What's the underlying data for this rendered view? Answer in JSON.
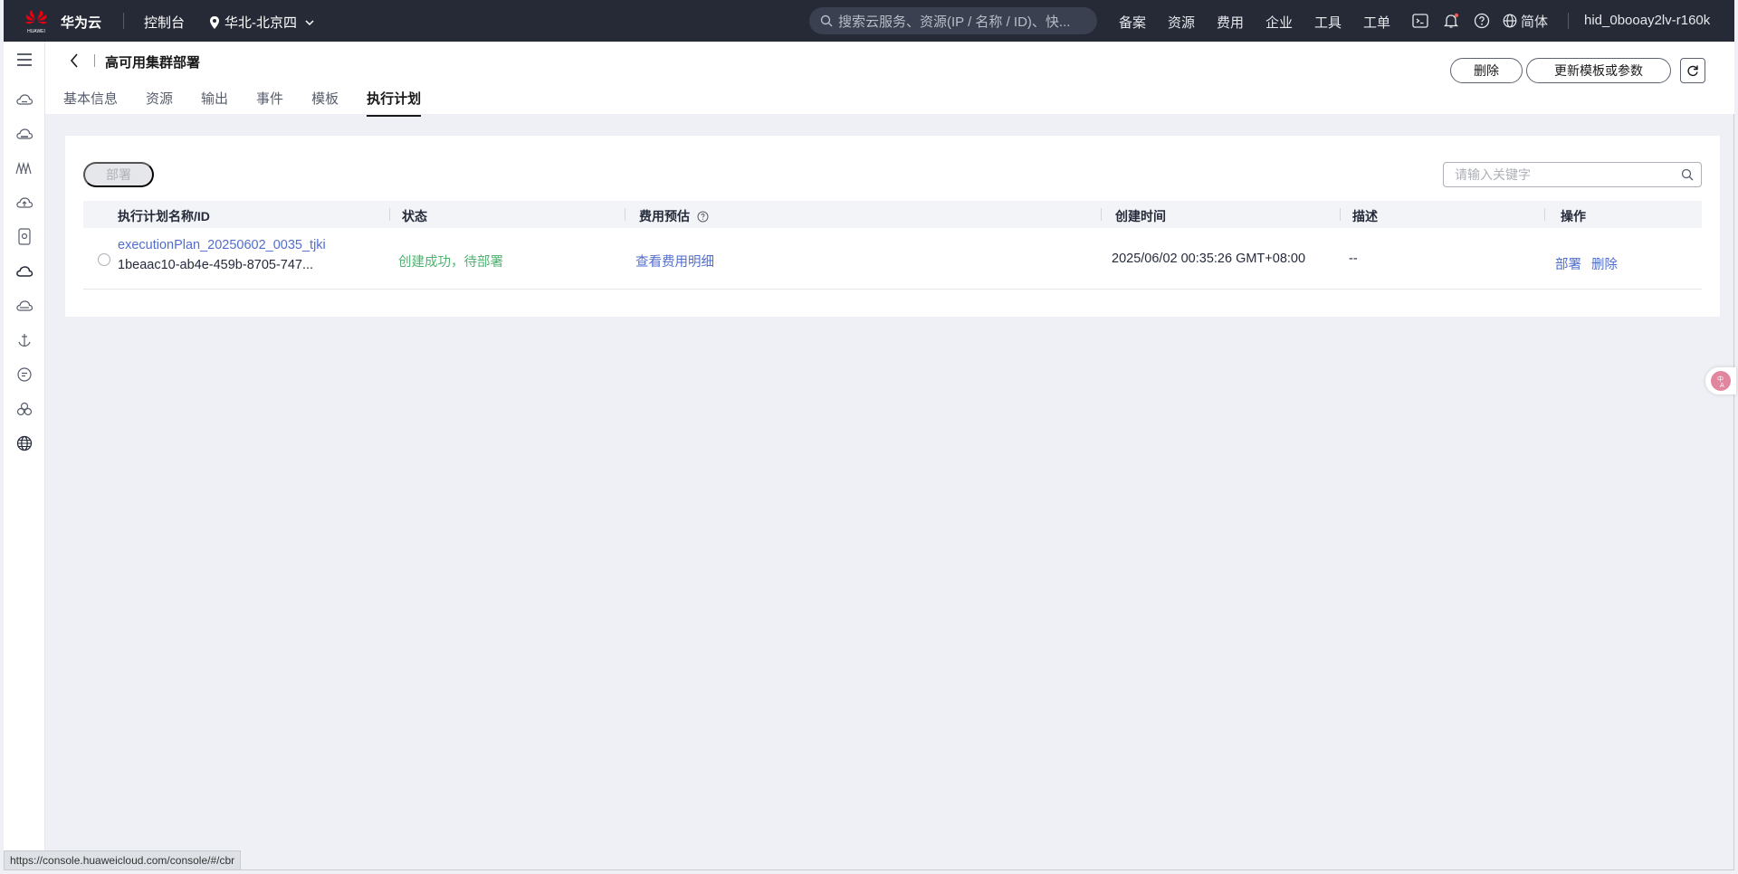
{
  "topbar": {
    "brand_text": "华为云",
    "console_label": "控制台",
    "region_label": "华北-北京四",
    "search_placeholder": "搜索云服务、资源(IP / 名称 / ID)、快...",
    "nav": [
      "备案",
      "资源",
      "费用",
      "企业",
      "工具",
      "工单"
    ],
    "lang_label": "简体",
    "user_name": "hid_0booay2lv-r160k"
  },
  "leftnav": {
    "icons": [
      "menu-icon",
      "cloud-server-icon",
      "cloud-storage-icon",
      "vpc-icon",
      "cloud-upload-icon",
      "database-icon",
      "cloud-icon",
      "cloud-alt-icon",
      "anchor-icon",
      "chat-icon",
      "cluster-icon",
      "globe-icon"
    ]
  },
  "header": {
    "title": "高可用集群部署",
    "tabs": [
      "基本信息",
      "资源",
      "输出",
      "事件",
      "模板",
      "执行计划"
    ],
    "active_tab": "执行计划",
    "delete_label": "删除",
    "update_label": "更新模板或参数"
  },
  "toolbar": {
    "deploy_label": "部署",
    "search_placeholder": "请输入关键字"
  },
  "table": {
    "headers": {
      "name": "执行计划名称/ID",
      "status": "状态",
      "cost": "费用预估",
      "created": "创建时间",
      "desc": "描述",
      "ops": "操作"
    },
    "rows": [
      {
        "name": "executionPlan_20250602_0035_tjki",
        "id": "1beaac10-ab4e-459b-8705-747...",
        "status": "创建成功，待部署",
        "cost_link": "查看费用明细",
        "created": "2025/06/02 00:35:26 GMT+08:00",
        "desc": "--",
        "op_deploy": "部署",
        "op_delete": "删除"
      }
    ]
  },
  "statusbar": {
    "url": "https://console.huaweicloud.com/console/#/cbr"
  },
  "colors": {
    "topbar_bg": "#252a36",
    "link": "#526ecc",
    "status_success": "#50b371",
    "page_bg": "#eef0f5"
  }
}
